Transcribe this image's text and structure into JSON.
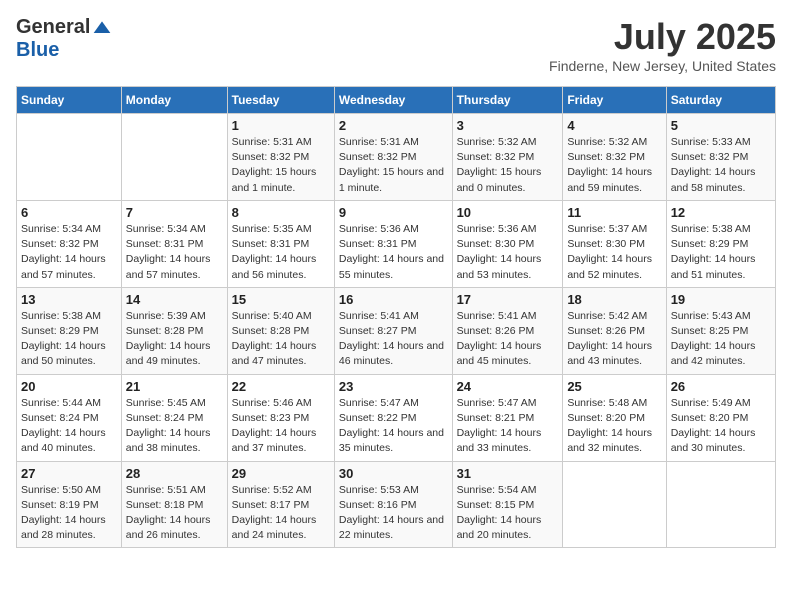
{
  "header": {
    "logo_general": "General",
    "logo_blue": "Blue",
    "title": "July 2025",
    "location": "Finderne, New Jersey, United States"
  },
  "weekdays": [
    "Sunday",
    "Monday",
    "Tuesday",
    "Wednesday",
    "Thursday",
    "Friday",
    "Saturday"
  ],
  "weeks": [
    [
      {
        "day": "",
        "detail": ""
      },
      {
        "day": "",
        "detail": ""
      },
      {
        "day": "1",
        "detail": "Sunrise: 5:31 AM\nSunset: 8:32 PM\nDaylight: 15 hours and 1 minute."
      },
      {
        "day": "2",
        "detail": "Sunrise: 5:31 AM\nSunset: 8:32 PM\nDaylight: 15 hours and 1 minute."
      },
      {
        "day": "3",
        "detail": "Sunrise: 5:32 AM\nSunset: 8:32 PM\nDaylight: 15 hours and 0 minutes."
      },
      {
        "day": "4",
        "detail": "Sunrise: 5:32 AM\nSunset: 8:32 PM\nDaylight: 14 hours and 59 minutes."
      },
      {
        "day": "5",
        "detail": "Sunrise: 5:33 AM\nSunset: 8:32 PM\nDaylight: 14 hours and 58 minutes."
      }
    ],
    [
      {
        "day": "6",
        "detail": "Sunrise: 5:34 AM\nSunset: 8:32 PM\nDaylight: 14 hours and 57 minutes."
      },
      {
        "day": "7",
        "detail": "Sunrise: 5:34 AM\nSunset: 8:31 PM\nDaylight: 14 hours and 57 minutes."
      },
      {
        "day": "8",
        "detail": "Sunrise: 5:35 AM\nSunset: 8:31 PM\nDaylight: 14 hours and 56 minutes."
      },
      {
        "day": "9",
        "detail": "Sunrise: 5:36 AM\nSunset: 8:31 PM\nDaylight: 14 hours and 55 minutes."
      },
      {
        "day": "10",
        "detail": "Sunrise: 5:36 AM\nSunset: 8:30 PM\nDaylight: 14 hours and 53 minutes."
      },
      {
        "day": "11",
        "detail": "Sunrise: 5:37 AM\nSunset: 8:30 PM\nDaylight: 14 hours and 52 minutes."
      },
      {
        "day": "12",
        "detail": "Sunrise: 5:38 AM\nSunset: 8:29 PM\nDaylight: 14 hours and 51 minutes."
      }
    ],
    [
      {
        "day": "13",
        "detail": "Sunrise: 5:38 AM\nSunset: 8:29 PM\nDaylight: 14 hours and 50 minutes."
      },
      {
        "day": "14",
        "detail": "Sunrise: 5:39 AM\nSunset: 8:28 PM\nDaylight: 14 hours and 49 minutes."
      },
      {
        "day": "15",
        "detail": "Sunrise: 5:40 AM\nSunset: 8:28 PM\nDaylight: 14 hours and 47 minutes."
      },
      {
        "day": "16",
        "detail": "Sunrise: 5:41 AM\nSunset: 8:27 PM\nDaylight: 14 hours and 46 minutes."
      },
      {
        "day": "17",
        "detail": "Sunrise: 5:41 AM\nSunset: 8:26 PM\nDaylight: 14 hours and 45 minutes."
      },
      {
        "day": "18",
        "detail": "Sunrise: 5:42 AM\nSunset: 8:26 PM\nDaylight: 14 hours and 43 minutes."
      },
      {
        "day": "19",
        "detail": "Sunrise: 5:43 AM\nSunset: 8:25 PM\nDaylight: 14 hours and 42 minutes."
      }
    ],
    [
      {
        "day": "20",
        "detail": "Sunrise: 5:44 AM\nSunset: 8:24 PM\nDaylight: 14 hours and 40 minutes."
      },
      {
        "day": "21",
        "detail": "Sunrise: 5:45 AM\nSunset: 8:24 PM\nDaylight: 14 hours and 38 minutes."
      },
      {
        "day": "22",
        "detail": "Sunrise: 5:46 AM\nSunset: 8:23 PM\nDaylight: 14 hours and 37 minutes."
      },
      {
        "day": "23",
        "detail": "Sunrise: 5:47 AM\nSunset: 8:22 PM\nDaylight: 14 hours and 35 minutes."
      },
      {
        "day": "24",
        "detail": "Sunrise: 5:47 AM\nSunset: 8:21 PM\nDaylight: 14 hours and 33 minutes."
      },
      {
        "day": "25",
        "detail": "Sunrise: 5:48 AM\nSunset: 8:20 PM\nDaylight: 14 hours and 32 minutes."
      },
      {
        "day": "26",
        "detail": "Sunrise: 5:49 AM\nSunset: 8:20 PM\nDaylight: 14 hours and 30 minutes."
      }
    ],
    [
      {
        "day": "27",
        "detail": "Sunrise: 5:50 AM\nSunset: 8:19 PM\nDaylight: 14 hours and 28 minutes."
      },
      {
        "day": "28",
        "detail": "Sunrise: 5:51 AM\nSunset: 8:18 PM\nDaylight: 14 hours and 26 minutes."
      },
      {
        "day": "29",
        "detail": "Sunrise: 5:52 AM\nSunset: 8:17 PM\nDaylight: 14 hours and 24 minutes."
      },
      {
        "day": "30",
        "detail": "Sunrise: 5:53 AM\nSunset: 8:16 PM\nDaylight: 14 hours and 22 minutes."
      },
      {
        "day": "31",
        "detail": "Sunrise: 5:54 AM\nSunset: 8:15 PM\nDaylight: 14 hours and 20 minutes."
      },
      {
        "day": "",
        "detail": ""
      },
      {
        "day": "",
        "detail": ""
      }
    ]
  ]
}
